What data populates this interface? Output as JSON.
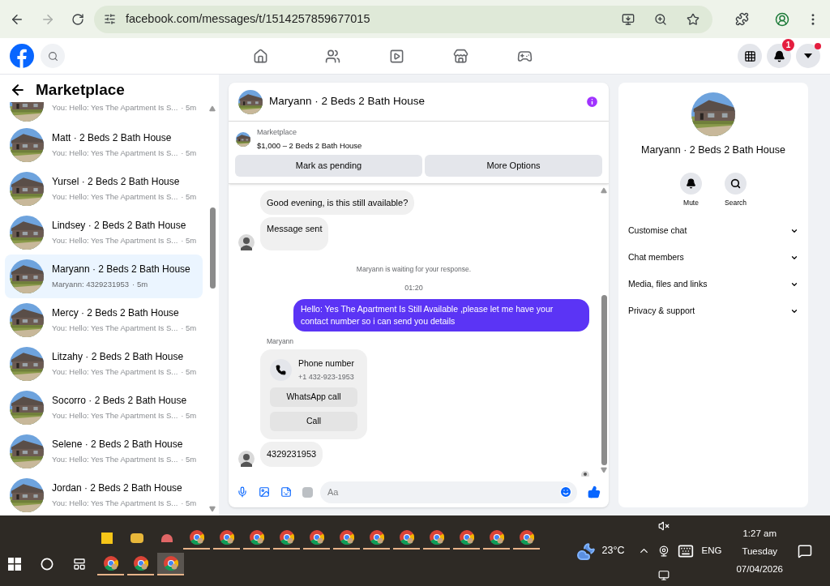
{
  "browser": {
    "url": "facebook.com/messages/t/1514257859677015",
    "forward_enabled": false
  },
  "topbar": {
    "notification_badge": "1",
    "account_dot": true
  },
  "sidebar": {
    "title": "Marketplace",
    "conversations": [
      {
        "preview": "You: Hello: Yes The Apartment Is S...",
        "time": "· 5m",
        "selected": false
      },
      {
        "name": "Matt · 2 Beds 2 Bath House",
        "preview": "You: Hello: Yes The Apartment Is S...",
        "time": "· 5m",
        "selected": false
      },
      {
        "name": "Yursel · 2 Beds 2 Bath House",
        "preview": "You: Hello: Yes The Apartment Is S...",
        "time": "· 5m",
        "selected": false
      },
      {
        "name": "Lindsey · 2 Beds 2 Bath House",
        "preview": "You: Hello: Yes The Apartment Is S...",
        "time": "· 5m",
        "selected": false
      },
      {
        "name": "Maryann · 2 Beds 2 Bath House",
        "preview": "Maryann: 4329231953",
        "time": "· 5m",
        "selected": true
      },
      {
        "name": "Mercy · 2 Beds 2 Bath House",
        "preview": "You: Hello: Yes The Apartment Is S...",
        "time": "· 5m",
        "selected": false
      },
      {
        "name": "Litzahy · 2 Beds 2 Bath House",
        "preview": "You: Hello: Yes The Apartment Is S...",
        "time": "· 5m",
        "selected": false
      },
      {
        "name": "Socorro · 2 Beds 2 Bath House",
        "preview": "You: Hello: Yes The Apartment Is S...",
        "time": "· 5m",
        "selected": false
      },
      {
        "name": "Selene · 2 Beds 2 Bath House",
        "preview": "You: Hello: Yes The Apartment Is S...",
        "time": "· 5m",
        "selected": false
      },
      {
        "name": "Jordan · 2 Beds 2 Bath House",
        "preview": "You: Hello: Yes The Apartment Is S...",
        "time": "· 5m",
        "selected": false
      }
    ]
  },
  "chat": {
    "title": "Maryann · 2 Beds 2 Bath House",
    "listing": {
      "label": "Marketplace",
      "title": "$1,000 – 2 Beds 2 Bath House"
    },
    "buttons": [
      "Mark as pending",
      "More Options"
    ],
    "messages": [
      {
        "kind": "incoming",
        "text": "Good evening, is this still available?",
        "avatar": false
      },
      {
        "kind": "incoming",
        "text": "Message sent",
        "avatar": true
      },
      {
        "kind": "notice",
        "text": "Maryann is waiting for your response."
      },
      {
        "kind": "time",
        "text": "01:20"
      },
      {
        "kind": "outgoing",
        "text": "Hello: Yes The Apartment Is Still Available ,please let me have your contact number so i can send you details"
      },
      {
        "kind": "contact",
        "sender": "Maryann",
        "title": "Phone number",
        "number": "+1 432-923-1953",
        "actions": [
          "WhatsApp call",
          "Call"
        ]
      },
      {
        "kind": "incoming",
        "text": "4329231953",
        "avatar": true
      }
    ],
    "composer": {
      "placeholder": "Aa"
    }
  },
  "details": {
    "title": "Maryann · 2 Beds 2 Bath House",
    "actions": [
      {
        "kind": "mute",
        "label": "Mute"
      },
      {
        "kind": "search",
        "label": "Search"
      }
    ],
    "sections": [
      "Customise chat",
      "Chat members",
      "Media, files and links",
      "Privacy & support"
    ]
  },
  "taskbar": {
    "temperature": "23°C",
    "language": "ENG",
    "time": "1:27 am",
    "day": "Tuesday",
    "date": "07/04/2026"
  }
}
